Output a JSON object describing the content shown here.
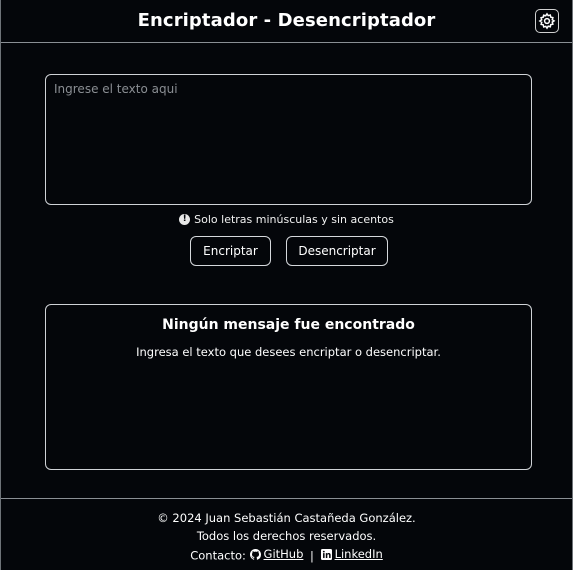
{
  "header": {
    "title": "Encriptador - Desencriptador",
    "settings_icon": "gear-icon"
  },
  "input": {
    "placeholder": "Ingrese el texto aqui",
    "value": ""
  },
  "hint": {
    "icon": "info-icon",
    "symbol": "!",
    "text": "Solo letras minúsculas y sin acentos"
  },
  "actions": {
    "encrypt_label": "Encriptar",
    "decrypt_label": "Desencriptar"
  },
  "output": {
    "title": "Ningún mensaje fue encontrado",
    "message": "Ingresa el texto que desees encriptar o desencriptar."
  },
  "footer": {
    "copyright": "© 2024 Juan Sebastián Castañeda González.",
    "rights": "Todos los derechos reservados.",
    "contact_label": "Contacto:",
    "separator": "|",
    "github_label": "GitHub",
    "github_icon": "github-icon",
    "linkedin_label": "LinkedIn",
    "linkedin_icon": "linkedin-icon"
  },
  "colors": {
    "background": "#04060a",
    "text": "#ffffff",
    "border": "#cfd2d6"
  }
}
